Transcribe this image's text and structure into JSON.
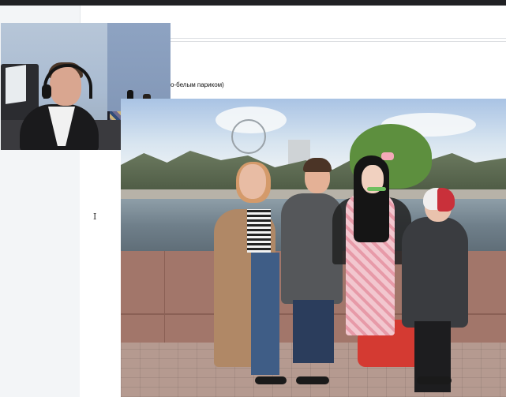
{
  "document": {
    "caption_fragment": "о-белым париком)"
  },
  "cursor_glyph": "I",
  "icons": {
    "text_cursor": "i-beam-cursor-icon"
  },
  "colors": {
    "titlebar": "#202124",
    "sidebar": "#f3f5f7",
    "page": "#ffffff"
  }
}
